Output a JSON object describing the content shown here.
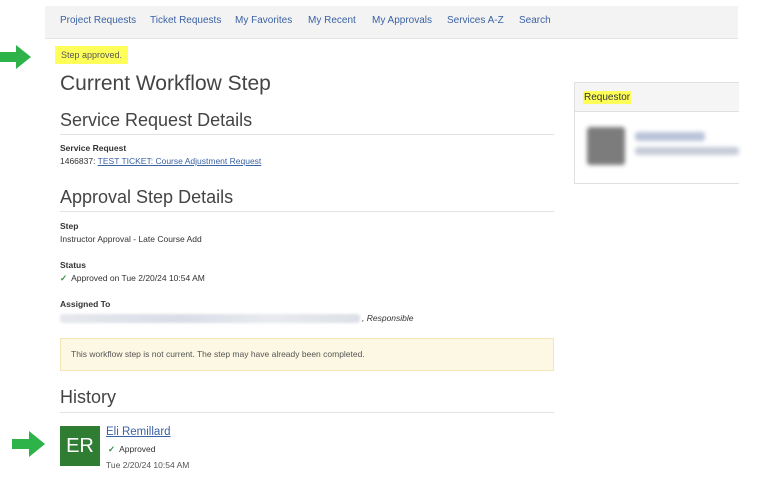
{
  "nav": {
    "items": [
      "Project Requests",
      "Ticket Requests",
      "My Favorites",
      "My Recent",
      "My Approvals",
      "Services A-Z",
      "Search"
    ]
  },
  "flash": {
    "message": "Step approved."
  },
  "page": {
    "title": "Current Workflow Step"
  },
  "service_request": {
    "heading": "Service Request Details",
    "label": "Service Request",
    "id": "1466837:",
    "link_text": "TEST TICKET: Course Adjustment Request"
  },
  "approval": {
    "heading": "Approval Step Details",
    "step_label": "Step",
    "step_value": "Instructor Approval - Late Course Add",
    "status_label": "Status",
    "status_value": "Approved on Tue 2/20/24 10:54 AM",
    "assigned_label": "Assigned To",
    "assigned_suffix": ", Responsible"
  },
  "alert": {
    "text": "This workflow step is not current. The step may have already been completed."
  },
  "history": {
    "heading": "History",
    "entries": [
      {
        "initials": "ER",
        "name": "Eli Remillard",
        "status": "Approved",
        "time": "Tue 2/20/24 10:54 AM"
      }
    ]
  },
  "requestor": {
    "title": "Requestor"
  },
  "icons": {
    "check": "check-icon",
    "arrow": "arrow-right-icon"
  },
  "colors": {
    "accent": "#3b62a3",
    "highlight": "#ffff5a",
    "success": "#2f8f3f",
    "arrow": "#2eb34a",
    "avatar": "#2e7d32"
  }
}
